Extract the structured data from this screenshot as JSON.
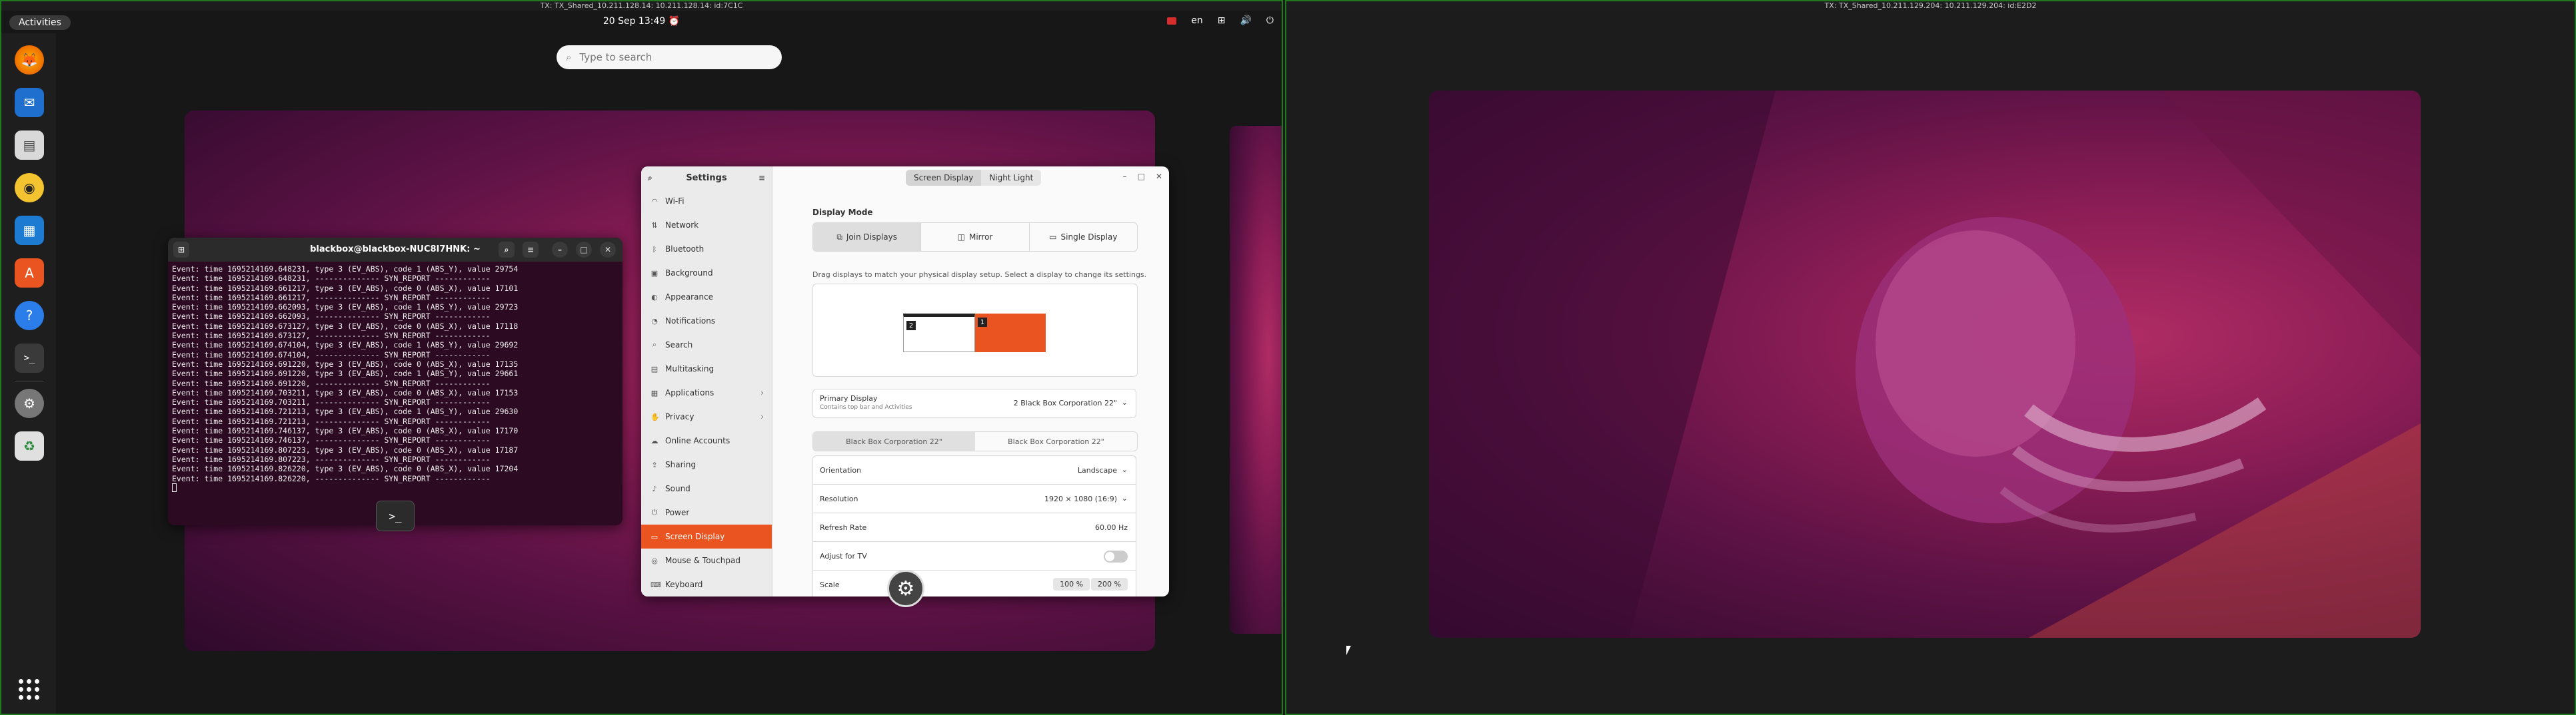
{
  "left_screen": {
    "title": "TX: TX_Shared_10.211.128.14: 10.211.128.14: id:7C1C",
    "topbar": {
      "activities": "Activities",
      "clock": "20 Sep  13:49",
      "lang": "en"
    },
    "search": {
      "placeholder": "Type to search"
    },
    "dock": [
      "firefox-icon",
      "thunderbird-icon",
      "files-icon",
      "rhythmbox-icon",
      "writer-icon",
      "app-center-icon",
      "help-icon",
      "terminal-icon",
      "settings-icon",
      "trash-icon"
    ],
    "terminal": {
      "title": "blackbox@blackbox-NUC8I7HNK: ~",
      "lines": [
        "Event: time 1695214169.648231, type 3 (EV_ABS), code 1 (ABS_Y), value 29754",
        "Event: time 1695214169.648231, -------------- SYN_REPORT ------------",
        "Event: time 1695214169.661217, type 3 (EV_ABS), code 0 (ABS_X), value 17101",
        "Event: time 1695214169.661217, -------------- SYN_REPORT ------------",
        "Event: time 1695214169.662093, type 3 (EV_ABS), code 1 (ABS_Y), value 29723",
        "Event: time 1695214169.662093, -------------- SYN_REPORT ------------",
        "Event: time 1695214169.673127, type 3 (EV_ABS), code 0 (ABS_X), value 17118",
        "Event: time 1695214169.673127, -------------- SYN_REPORT ------------",
        "Event: time 1695214169.674104, type 3 (EV_ABS), code 1 (ABS_Y), value 29692",
        "Event: time 1695214169.674104, -------------- SYN_REPORT ------------",
        "Event: time 1695214169.691220, type 3 (EV_ABS), code 0 (ABS_X), value 17135",
        "Event: time 1695214169.691220, type 3 (EV_ABS), code 1 (ABS_Y), value 29661",
        "Event: time 1695214169.691220, -------------- SYN_REPORT ------------",
        "Event: time 1695214169.703211, type 3 (EV_ABS), code 0 (ABS_X), value 17153",
        "Event: time 1695214169.703211, -------------- SYN_REPORT ------------",
        "Event: time 1695214169.721213, type 3 (EV_ABS), code 1 (ABS_Y), value 29630",
        "Event: time 1695214169.721213, -------------- SYN_REPORT ------------",
        "Event: time 1695214169.746137, type 3 (EV_ABS), code 0 (ABS_X), value 17170",
        "Event: time 1695214169.746137, -------------- SYN_REPORT ------------",
        "Event: time 1695214169.807223, type 3 (EV_ABS), code 0 (ABS_X), value 17187",
        "Event: time 1695214169.807223, -------------- SYN_REPORT ------------",
        "Event: time 1695214169.826220, type 3 (EV_ABS), code 0 (ABS_X), value 17204",
        "Event: time 1695214169.826220, -------------- SYN_REPORT ------------"
      ],
      "badge": ">_"
    },
    "settings": {
      "sidebar_title": "Settings",
      "tabs": [
        "Screen Display",
        "Night Light"
      ],
      "nav": [
        {
          "label": "Wi-Fi",
          "icon": "wifi-icon"
        },
        {
          "label": "Network",
          "icon": "network-icon"
        },
        {
          "label": "Bluetooth",
          "icon": "bluetooth-icon"
        },
        {
          "label": "Background",
          "icon": "background-icon"
        },
        {
          "label": "Appearance",
          "icon": "appearance-icon"
        },
        {
          "label": "Notifications",
          "icon": "bell-icon"
        },
        {
          "label": "Search",
          "icon": "search-icon"
        },
        {
          "label": "Multitasking",
          "icon": "multitasking-icon"
        },
        {
          "label": "Applications",
          "icon": "apps-icon"
        },
        {
          "label": "Privacy",
          "icon": "privacy-icon"
        },
        {
          "label": "Online Accounts",
          "icon": "accounts-icon"
        },
        {
          "label": "Sharing",
          "icon": "sharing-icon"
        },
        {
          "label": "Sound",
          "icon": "sound-icon"
        },
        {
          "label": "Power",
          "icon": "power-icon"
        },
        {
          "label": "Screen Display",
          "icon": "display-icon"
        },
        {
          "label": "Mouse & Touchpad",
          "icon": "mouse-icon"
        },
        {
          "label": "Keyboard",
          "icon": "keyboard-icon"
        }
      ],
      "display_mode_title": "Display Mode",
      "modes": [
        "Join Displays",
        "Mirror",
        "Single Display"
      ],
      "hint": "Drag displays to match your physical display setup. Select a display to change its settings.",
      "monitor_1": "1",
      "monitor_2": "2",
      "primary_label": "Primary Display",
      "primary_sub": "Contains top bar and Activities",
      "primary_value": "2  Black Box Corporation 22\"",
      "monitor_tabs": [
        "Black Box Corporation 22\"",
        "Black Box Corporation 22\""
      ],
      "orientation_label": "Orientation",
      "orientation_value": "Landscape",
      "resolution_label": "Resolution",
      "resolution_value": "1920 × 1080 (16:9)",
      "refresh_label": "Refresh Rate",
      "refresh_value": "60.00 Hz",
      "adjust_tv_label": "Adjust for TV",
      "adjust_tv_on": false,
      "scale_label": "Scale",
      "scale_options": [
        "100 %",
        "200 %"
      ]
    }
  },
  "right_screen": {
    "title": "TX: TX_Shared_10.211.129.204: 10.211.129.204: id:E2D2"
  },
  "colors": {
    "accent": "#e95420",
    "terminal_bg": "#2c0a22"
  }
}
